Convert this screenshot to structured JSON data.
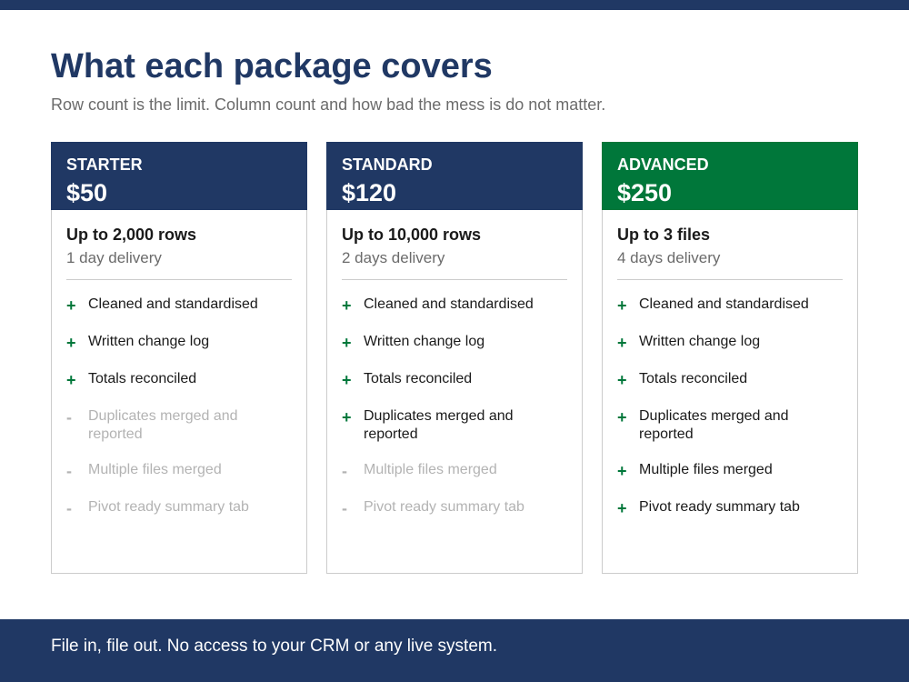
{
  "page": {
    "title": "What each package covers",
    "subtitle": "Row count is the limit. Column count and how bad the mess is do not matter."
  },
  "colors": {
    "navy": "#203864",
    "green": "#00773a",
    "included_marker": "#00773a",
    "excluded_text": "#b3b3b3"
  },
  "packages": [
    {
      "name": "STARTER",
      "price": "$50",
      "limit": "Up to 2,000 rows",
      "delivery": "1 day delivery",
      "features": [
        {
          "marker": "+",
          "text": "Cleaned and standardised",
          "included": true
        },
        {
          "marker": "+",
          "text": "Written change log",
          "included": true
        },
        {
          "marker": "+",
          "text": "Totals reconciled",
          "included": true
        },
        {
          "marker": "-",
          "text": "Duplicates merged and reported",
          "included": false
        },
        {
          "marker": "-",
          "text": "Multiple files merged",
          "included": false
        },
        {
          "marker": "-",
          "text": "Pivot ready summary tab",
          "included": false
        }
      ]
    },
    {
      "name": "STANDARD",
      "price": "$120",
      "limit": "Up to 10,000 rows",
      "delivery": "2 days delivery",
      "features": [
        {
          "marker": "+",
          "text": "Cleaned and standardised",
          "included": true
        },
        {
          "marker": "+",
          "text": "Written change log",
          "included": true
        },
        {
          "marker": "+",
          "text": "Totals reconciled",
          "included": true
        },
        {
          "marker": "+",
          "text": "Duplicates merged and reported",
          "included": true
        },
        {
          "marker": "-",
          "text": "Multiple files merged",
          "included": false
        },
        {
          "marker": "-",
          "text": "Pivot ready summary tab",
          "included": false
        }
      ]
    },
    {
      "name": "ADVANCED",
      "price": "$250",
      "limit": "Up to 3 files",
      "delivery": "4 days delivery",
      "features": [
        {
          "marker": "+",
          "text": "Cleaned and standardised",
          "included": true
        },
        {
          "marker": "+",
          "text": "Written change log",
          "included": true
        },
        {
          "marker": "+",
          "text": "Totals reconciled",
          "included": true
        },
        {
          "marker": "+",
          "text": "Duplicates merged and reported",
          "included": true
        },
        {
          "marker": "+",
          "text": "Multiple files merged",
          "included": true
        },
        {
          "marker": "+",
          "text": "Pivot ready summary tab",
          "included": true
        }
      ]
    }
  ],
  "footer": {
    "text": "File in, file out. No access to your CRM or any live system."
  }
}
